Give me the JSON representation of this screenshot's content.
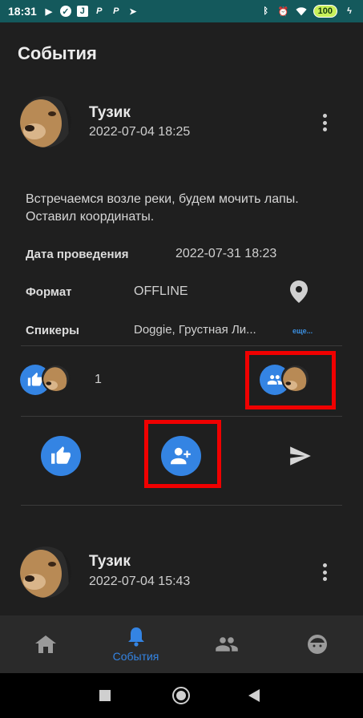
{
  "status_bar": {
    "time": "18:31",
    "battery": "100",
    "left_icons": [
      "play-icon",
      "check-badge-icon",
      "j-app-icon",
      "p-app-icon",
      "p-app-icon",
      "telegram-icon"
    ],
    "right_icons": [
      "bluetooth-icon",
      "alarm-icon",
      "wifi-icon",
      "battery-icon",
      "charging-icon"
    ]
  },
  "header": {
    "title": "События"
  },
  "posts": [
    {
      "author": "Тузик",
      "date": "2022-07-04 18:25",
      "text": "Встречаемся возле реки, будем мочить лапы. Оставил координаты.",
      "event_date_label": "Дата проведения",
      "event_date_value": "2022-07-31 18:23",
      "format_label": "Формат",
      "format_value": "OFFLINE",
      "speakers_label": "Спикеры",
      "speakers_value": "Doggie, Грустная Ли...",
      "speakers_more": "еще...",
      "likes_count": "1"
    },
    {
      "author": "Тузик",
      "date": "2022-07-04 15:43"
    }
  ],
  "bottom_nav": {
    "items": [
      {
        "icon": "home-icon",
        "label": ""
      },
      {
        "icon": "bell-icon",
        "label": "События",
        "active": true
      },
      {
        "icon": "people-icon",
        "label": ""
      },
      {
        "icon": "face-icon",
        "label": ""
      }
    ]
  },
  "colors": {
    "accent": "#3484e3",
    "highlight": "#f00000",
    "status_bar": "#14595c"
  }
}
